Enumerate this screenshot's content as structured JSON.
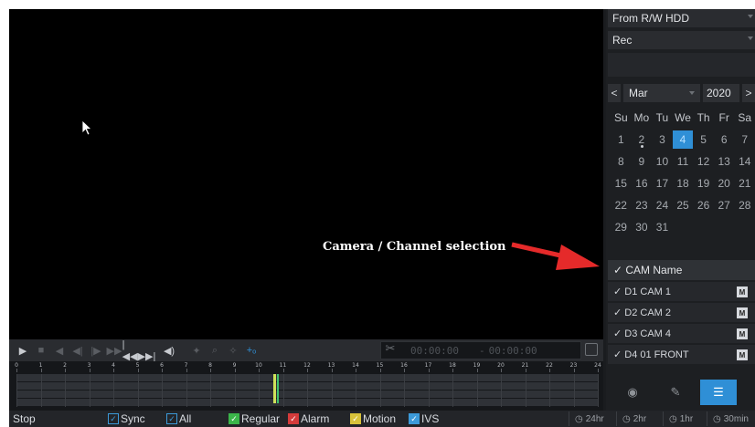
{
  "source": {
    "value": "From R/W HDD"
  },
  "record_type": {
    "value": "Rec"
  },
  "calendar": {
    "prev": "<",
    "next": ">",
    "month": "Mar",
    "year": "2020",
    "weekdays": [
      "Su",
      "Mo",
      "Tu",
      "We",
      "Th",
      "Fr",
      "Sa"
    ],
    "weeks": [
      [
        "1",
        "2",
        "3",
        "4",
        "5",
        "6",
        "7"
      ],
      [
        "8",
        "9",
        "10",
        "11",
        "12",
        "13",
        "14"
      ],
      [
        "15",
        "16",
        "17",
        "18",
        "19",
        "20",
        "21"
      ],
      [
        "22",
        "23",
        "24",
        "25",
        "26",
        "27",
        "28"
      ],
      [
        "29",
        "30",
        "31",
        "",
        "",
        "",
        ""
      ]
    ],
    "selected_day": "4",
    "days_with_recordings": [
      "2",
      "4"
    ]
  },
  "channels": {
    "header": "✓ CAM Name",
    "items": [
      {
        "label": "✓ D1 CAM 1",
        "badge": "M"
      },
      {
        "label": "✓ D2 CAM 2",
        "badge": "M"
      },
      {
        "label": "✓ D3 CAM 4",
        "badge": "M"
      },
      {
        "label": "✓ D4 01 FRONT",
        "badge": "M"
      }
    ]
  },
  "annotation": {
    "text": "Camera / Channel selection",
    "color": "#e52a2a"
  },
  "clip": {
    "start": "00:00:00",
    "separator": "-",
    "end": "00:00:00"
  },
  "timeline": {
    "hours": [
      "0",
      "1",
      "2",
      "3",
      "4",
      "5",
      "6",
      "7",
      "8",
      "9",
      "10",
      "11",
      "12",
      "13",
      "14",
      "15",
      "16",
      "17",
      "18",
      "19",
      "20",
      "21",
      "22",
      "23",
      "24"
    ],
    "recording_hour": 10.6
  },
  "statusbar": {
    "state": "Stop",
    "filters": [
      {
        "label": "Sync",
        "style": "outline"
      },
      {
        "label": "All",
        "style": "outline"
      },
      {
        "label": "Regular",
        "style": "green"
      },
      {
        "label": "Alarm",
        "style": "red"
      },
      {
        "label": "Motion",
        "style": "yellow"
      },
      {
        "label": "IVS",
        "style": "blue"
      }
    ],
    "ranges": [
      "24hr",
      "2hr",
      "1hr",
      "30min"
    ]
  },
  "colors": {
    "accent": "#2f8fd6",
    "regular": "#3bb54a",
    "alarm": "#d43b3b",
    "motion": "#d8c23a"
  }
}
